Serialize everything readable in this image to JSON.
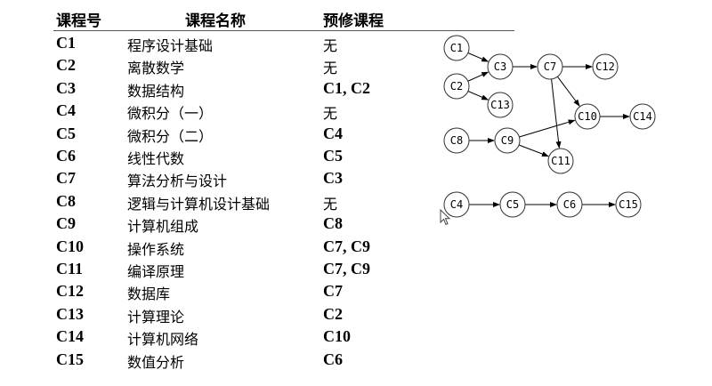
{
  "headers": {
    "id": "课程号",
    "name": "课程名称",
    "prereq": "预修课程"
  },
  "courses": [
    {
      "id": "C1",
      "name": "程序设计基础",
      "prereq": "无"
    },
    {
      "id": "C2",
      "name": "离散数学",
      "prereq": "无"
    },
    {
      "id": "C3",
      "name": "数据结构",
      "prereq": "C1, C2"
    },
    {
      "id": "C4",
      "name": "微积分（一）",
      "prereq": "无"
    },
    {
      "id": "C5",
      "name": "微积分（二）",
      "prereq": "C4"
    },
    {
      "id": "C6",
      "name": "线性代数",
      "prereq": "C5"
    },
    {
      "id": "C7",
      "name": "算法分析与设计",
      "prereq": "C3"
    },
    {
      "id": "C8",
      "name": "逻辑与计算机设计基础",
      "prereq": "无"
    },
    {
      "id": "C9",
      "name": "计算机组成",
      "prereq": "C8"
    },
    {
      "id": "C10",
      "name": "操作系统",
      "prereq": "C7, C9"
    },
    {
      "id": "C11",
      "name": "编译原理",
      "prereq": "C7, C9"
    },
    {
      "id": "C12",
      "name": "数据库",
      "prereq": "C7"
    },
    {
      "id": "C13",
      "name": "计算理论",
      "prereq": "C2"
    },
    {
      "id": "C14",
      "name": "计算机网络",
      "prereq": "C10"
    },
    {
      "id": "C15",
      "name": "数值分析",
      "prereq": "C6"
    }
  ],
  "graph": {
    "nodes": [
      "C1",
      "C2",
      "C3",
      "C13",
      "C7",
      "C12",
      "C10",
      "C14",
      "C8",
      "C9",
      "C11",
      "C4",
      "C5",
      "C6",
      "C15"
    ],
    "edges": [
      [
        "C1",
        "C3"
      ],
      [
        "C2",
        "C3"
      ],
      [
        "C2",
        "C13"
      ],
      [
        "C3",
        "C7"
      ],
      [
        "C7",
        "C12"
      ],
      [
        "C7",
        "C10"
      ],
      [
        "C7",
        "C11"
      ],
      [
        "C8",
        "C9"
      ],
      [
        "C9",
        "C10"
      ],
      [
        "C9",
        "C11"
      ],
      [
        "C10",
        "C14"
      ],
      [
        "C4",
        "C5"
      ],
      [
        "C5",
        "C6"
      ],
      [
        "C6",
        "C15"
      ]
    ]
  }
}
